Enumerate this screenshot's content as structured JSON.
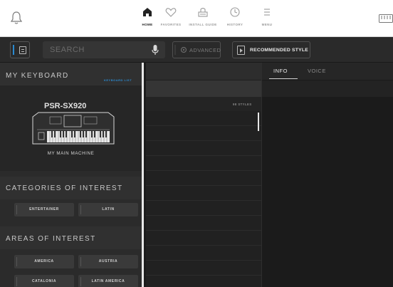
{
  "nav": {
    "items": [
      {
        "label": "HOME",
        "icon": "home-icon",
        "active": true
      },
      {
        "label": "FAVORITES",
        "icon": "heart-icon",
        "active": false
      },
      {
        "label": "INSTALL GUIDE",
        "icon": "install-guide-icon",
        "active": false
      },
      {
        "label": "HISTORY",
        "icon": "clock-icon",
        "active": false
      },
      {
        "label": "MENU",
        "icon": "menu-icon",
        "active": false
      }
    ]
  },
  "search": {
    "placeholder": "SEARCH",
    "advanced_label": "ADVANCED",
    "recommended_label": "RECOMMENDED STYLE"
  },
  "keyboard": {
    "section_title": "MY KEYBOARD",
    "list_link": "KEYBOARD LIST",
    "model_logo": "PSR-SX920",
    "machine_label": "MY MAIN MACHINE"
  },
  "categories": {
    "title": "CATEGORIES OF INTEREST",
    "items": [
      "ENTERTAINER",
      "LATIN"
    ]
  },
  "areas": {
    "title": "AREAS OF INTEREST",
    "items": [
      "AMERICA",
      "AUSTRIA",
      "CATALONIA",
      "LATIN AMERICA"
    ]
  },
  "styles": {
    "count_label": "98 STYLES"
  },
  "detail": {
    "tabs": [
      {
        "label": "INFO",
        "active": true
      },
      {
        "label": "VOICE",
        "active": false
      }
    ]
  },
  "colors": {
    "accent": "#2a8ad0",
    "panel": "#2b2b2b",
    "topbar": "#ffffff"
  }
}
